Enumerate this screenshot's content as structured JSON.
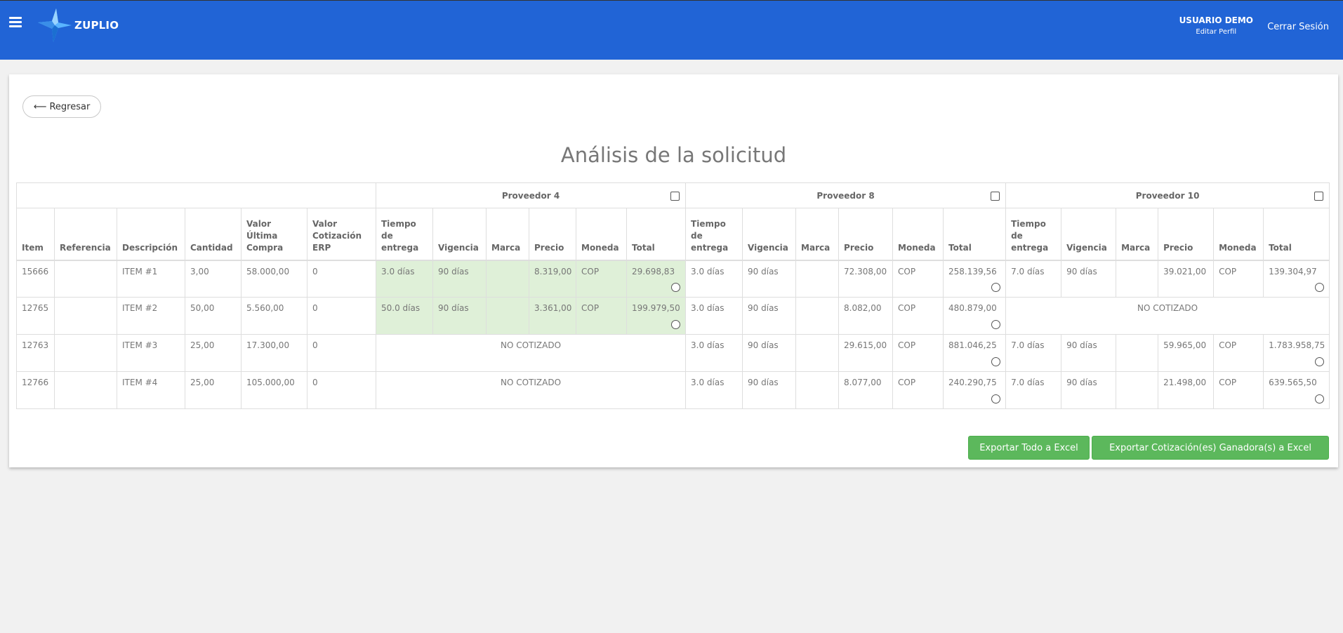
{
  "header": {
    "brand": "ZUPLIO",
    "user_name": "USUARIO DEMO",
    "edit_profile": "Editar Perfil",
    "logout": "Cerrar Sesión"
  },
  "back_label": "⟵ Regresar",
  "title": "Análisis de la solicitud",
  "providers": [
    "Proveedor 4",
    "Proveedor 8",
    "Proveedor 10"
  ],
  "columns": {
    "item": "Item",
    "referencia": "Referencia",
    "descripcion": "Descripción",
    "cantidad": "Cantidad",
    "valor_ultima": "Valor Última Compra",
    "valor_erp": "Valor Cotización ERP",
    "tiempo": "Tiempo de entrega",
    "vigencia": "Vigencia",
    "marca": "Marca",
    "precio": "Precio",
    "moneda": "Moneda",
    "total": "Total"
  },
  "no_cotizado": "NO COTIZADO",
  "rows": [
    {
      "item": "15666",
      "ref": "",
      "desc": "ITEM #1",
      "cant": "3,00",
      "ultima": "58.000,00",
      "erp": "0",
      "quotes": [
        {
          "tiempo": "3.0 días",
          "vigencia": "90 días",
          "marca": "",
          "precio": "8.319,00",
          "moneda": "COP",
          "total": "29.698,83"
        },
        {
          "tiempo": "3.0 días",
          "vigencia": "90 días",
          "marca": "",
          "precio": "72.308,00",
          "moneda": "COP",
          "total": "258.139,56"
        },
        {
          "tiempo": "7.0 días",
          "vigencia": "90 días",
          "marca": "",
          "precio": "39.021,00",
          "moneda": "COP",
          "total": "139.304,97"
        }
      ]
    },
    {
      "item": "12765",
      "ref": "",
      "desc": "ITEM #2",
      "cant": "50,00",
      "ultima": "5.560,00",
      "erp": "0",
      "quotes": [
        {
          "tiempo": "50.0 días",
          "vigencia": "90 días",
          "marca": "",
          "precio": "3.361,00",
          "moneda": "COP",
          "total": "199.979,50"
        },
        {
          "tiempo": "3.0 días",
          "vigencia": "90 días",
          "marca": "",
          "precio": "8.082,00",
          "moneda": "COP",
          "total": "480.879,00"
        }
      ]
    },
    {
      "item": "12763",
      "ref": "",
      "desc": "ITEM #3",
      "cant": "25,00",
      "ultima": "17.300,00",
      "erp": "0",
      "quotes": [
        {
          "tiempo": "3.0 días",
          "vigencia": "90 días",
          "marca": "",
          "precio": "29.615,00",
          "moneda": "COP",
          "total": "881.046,25"
        },
        {
          "tiempo": "7.0 días",
          "vigencia": "90 días",
          "marca": "",
          "precio": "59.965,00",
          "moneda": "COP",
          "total": "1.783.958,75"
        }
      ]
    },
    {
      "item": "12766",
      "ref": "",
      "desc": "ITEM #4",
      "cant": "25,00",
      "ultima": "105.000,00",
      "erp": "0",
      "quotes": [
        {
          "tiempo": "3.0 días",
          "vigencia": "90 días",
          "marca": "",
          "precio": "8.077,00",
          "moneda": "COP",
          "total": "240.290,75"
        },
        {
          "tiempo": "7.0 días",
          "vigencia": "90 días",
          "marca": "",
          "precio": "21.498,00",
          "moneda": "COP",
          "total": "639.565,50"
        }
      ]
    }
  ],
  "buttons": {
    "export_all": "Exportar Todo a Excel",
    "export_winners": "Exportar Cotización(es) Ganadora(s) a Excel"
  },
  "colors": {
    "header_bg": "#2164d6",
    "winner_bg": "#dff0d8",
    "button_green": "#5cb85c"
  }
}
